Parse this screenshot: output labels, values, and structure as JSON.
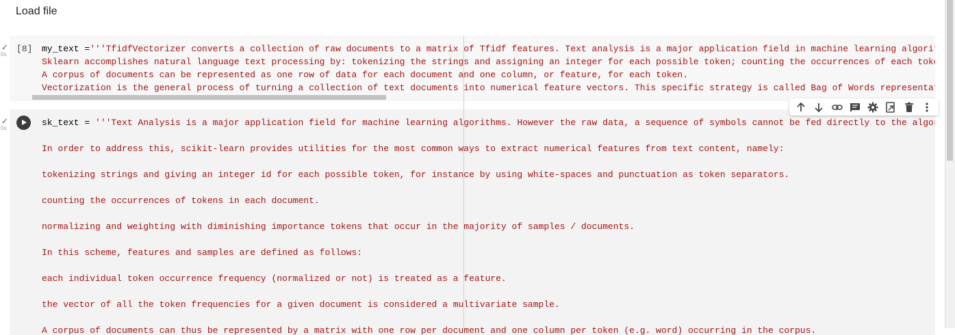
{
  "section": {
    "title": "Load file"
  },
  "cell1": {
    "exec_count": "[8]",
    "status_check": "✓",
    "status_time": "0s",
    "lines": [
      "my_text ='''TfidfVectorizer converts a collection of raw documents to a matrix of Tfidf features. Text analysis is a major application field in machine learning algorithm",
      "Sklearn accomplishes natural language text processing by: tokenizing the strings and assigning an integer for each possible token; counting the occurrences of each token",
      "A corpus of documents can be represented as one row of data for each document and one column, or feature, for each token.",
      "Vectorization is the general process of turning a collection of text documents into numerical feature vectors. This specific strategy is called Bag of Words representatio"
    ],
    "scroll_position": 0.0,
    "scroll_visible_fraction": 0.4
  },
  "cell2": {
    "status_check": "✓",
    "status_time": "0s",
    "first_line_var": "sk_text",
    "first_line_op": " = ",
    "first_line_str": "'''Text Analysis is a major application field for machine learning algorithms. However the raw data, a sequence of symbols cannot be fed directly to the algorith",
    "lines": [
      "",
      "In order to address this, scikit-learn provides utilities for the most common ways to extract numerical features from text content, namely:",
      "",
      "tokenizing strings and giving an integer id for each possible token, for instance by using white-spaces and punctuation as token separators.",
      "",
      "counting the occurrences of tokens in each document.",
      "",
      "normalizing and weighting with diminishing importance tokens that occur in the majority of samples / documents.",
      "",
      "In this scheme, features and samples are defined as follows:",
      "",
      "each individual token occurrence frequency (normalized or not) is treated as a feature.",
      "",
      "the vector of all the token frequencies for a given document is considered a multivariate sample.",
      "",
      "A corpus of documents can thus be represented by a matrix with one row per document and one column per token (e.g. word) occurring in the corpus."
    ]
  },
  "toolbar": {
    "icons": [
      "arrow-up-icon",
      "arrow-down-icon",
      "link-icon",
      "comment-icon",
      "gear-icon",
      "mirror-cell-icon",
      "trash-icon",
      "more-vert-icon"
    ]
  },
  "colors": {
    "cell_bg": "#f7f7f7",
    "string": "#a31515",
    "check": "#2e7d32"
  }
}
